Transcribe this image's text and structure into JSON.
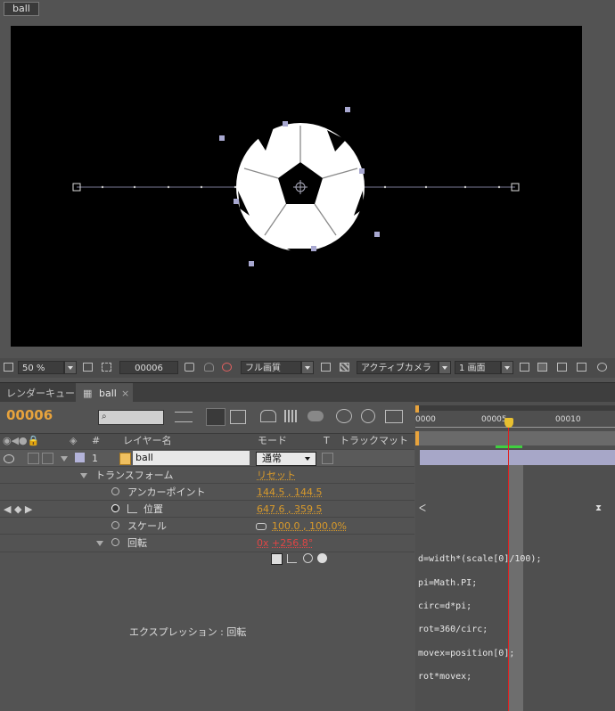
{
  "composition": {
    "tab_label": "ball"
  },
  "viewer_toolbar": {
    "zoom": "50 %",
    "timecode": "00006",
    "resolution": "フル画質",
    "camera": "アクティブカメラ",
    "view_layout": "1 画面"
  },
  "timeline": {
    "tabs": [
      {
        "label": "レンダーキュー"
      },
      {
        "label": "ball"
      }
    ],
    "current_time": "00006",
    "ruler": {
      "start": "0000",
      "mid": "00005",
      "end": "00010"
    },
    "columns": {
      "number": "#",
      "layer_name": "レイヤー名",
      "mode": "モード",
      "t": "T",
      "track_matte": "トラックマット"
    },
    "layer": {
      "index": "1",
      "name": "ball",
      "mode": "通常"
    },
    "properties": {
      "transform": "トランスフォーム",
      "reset": "リセット",
      "anchor": {
        "label": "アンカーポイント",
        "value": "144.5 , 144.5"
      },
      "position": {
        "label": "位置",
        "value": "647.6 , 359.5"
      },
      "scale": {
        "label": "スケール",
        "value": "100.0 , 100.0%"
      },
      "rotation": {
        "label": "回転",
        "rev": "0x",
        "deg": "+256.8°"
      }
    },
    "expression": {
      "label": "エクスプレッション : 回転",
      "lines": [
        "d=width*(scale[0]/100);",
        "pi=Math.PI;",
        "circ=d*pi;",
        "rot=360/circ;",
        "movex=position[0];",
        "rot*movex;"
      ]
    }
  },
  "colors": {
    "accent": "#e8a33c",
    "playhead": "#e02020",
    "value": "#d99a2a"
  }
}
